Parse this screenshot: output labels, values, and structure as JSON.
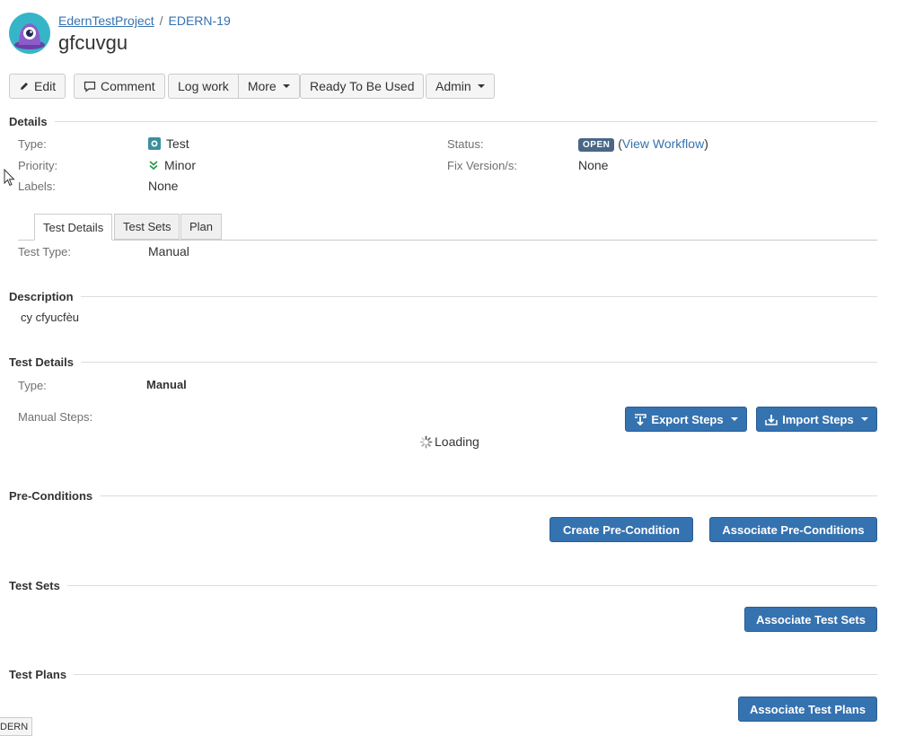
{
  "breadcrumb": {
    "project": "EdernTestProject",
    "separator": "/",
    "issue_key": "EDERN-19"
  },
  "issue_title": "gfcuvgu",
  "toolbar": {
    "edit": "Edit",
    "comment": "Comment",
    "log_work": "Log work",
    "more": "More",
    "ready": "Ready To Be Used",
    "admin": "Admin"
  },
  "details": {
    "heading": "Details",
    "type_label": "Type:",
    "type_value": "Test",
    "priority_label": "Priority:",
    "priority_value": "Minor",
    "labels_label": "Labels:",
    "labels_value": "None",
    "status_label": "Status:",
    "status_value": "OPEN",
    "view_workflow": "View Workflow",
    "fixversion_label": "Fix Version/s:",
    "fixversion_value": "None"
  },
  "tabs": [
    {
      "label": "Test Details",
      "active": true
    },
    {
      "label": "Test Sets",
      "active": false
    },
    {
      "label": "Plan",
      "active": false
    }
  ],
  "tab_content": {
    "test_type_label": "Test Type:",
    "test_type_value": "Manual"
  },
  "description": {
    "heading": "Description",
    "text": "cy cfyucfèu"
  },
  "test_details": {
    "heading": "Test Details",
    "type_label": "Type:",
    "type_value": "Manual",
    "steps_label": "Manual Steps:",
    "export_steps": "Export Steps",
    "import_steps": "Import Steps",
    "loading": "Loading"
  },
  "preconditions": {
    "heading": "Pre-Conditions",
    "create": "Create Pre-Condition",
    "associate": "Associate Pre-Conditions"
  },
  "test_sets": {
    "heading": "Test Sets",
    "associate": "Associate Test Sets"
  },
  "test_plans": {
    "heading": "Test Plans",
    "associate": "Associate Test Plans"
  },
  "footer_tag": "DERN",
  "colors": {
    "primary": "#3572b0",
    "lozenge": "#4a6785",
    "priority": "#2e9a4a",
    "test_icon": "#3b8f9e"
  }
}
